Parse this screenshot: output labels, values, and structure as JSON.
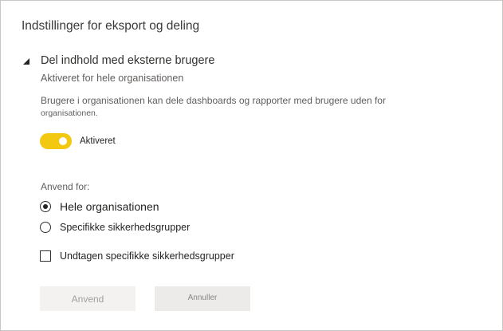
{
  "panel": {
    "title": "Indstillinger for eksport og deling"
  },
  "setting": {
    "title": "Del indhold med eksterne brugere",
    "status": "Aktiveret for hele organisationen",
    "description_line1": "Brugere i organisationen kan dele dashboards og rapporter med brugere uden for",
    "description_line2": "organisationen.",
    "toggle": {
      "state": "on",
      "label": "Aktiveret",
      "color": "#f2c811"
    },
    "apply_for": {
      "label": "Anvend for:",
      "options": [
        {
          "label": "Hele organisationen",
          "selected": true
        },
        {
          "label": "Specifikke sikkerhedsgrupper",
          "selected": false
        }
      ]
    },
    "exclude": {
      "label": "Undtagen specifikke sikkerhedsgrupper",
      "checked": false
    }
  },
  "buttons": {
    "apply_label": "Anvend",
    "cancel_label": "Annuller"
  },
  "icons": {
    "collapse": "collapse-triangle-icon"
  }
}
